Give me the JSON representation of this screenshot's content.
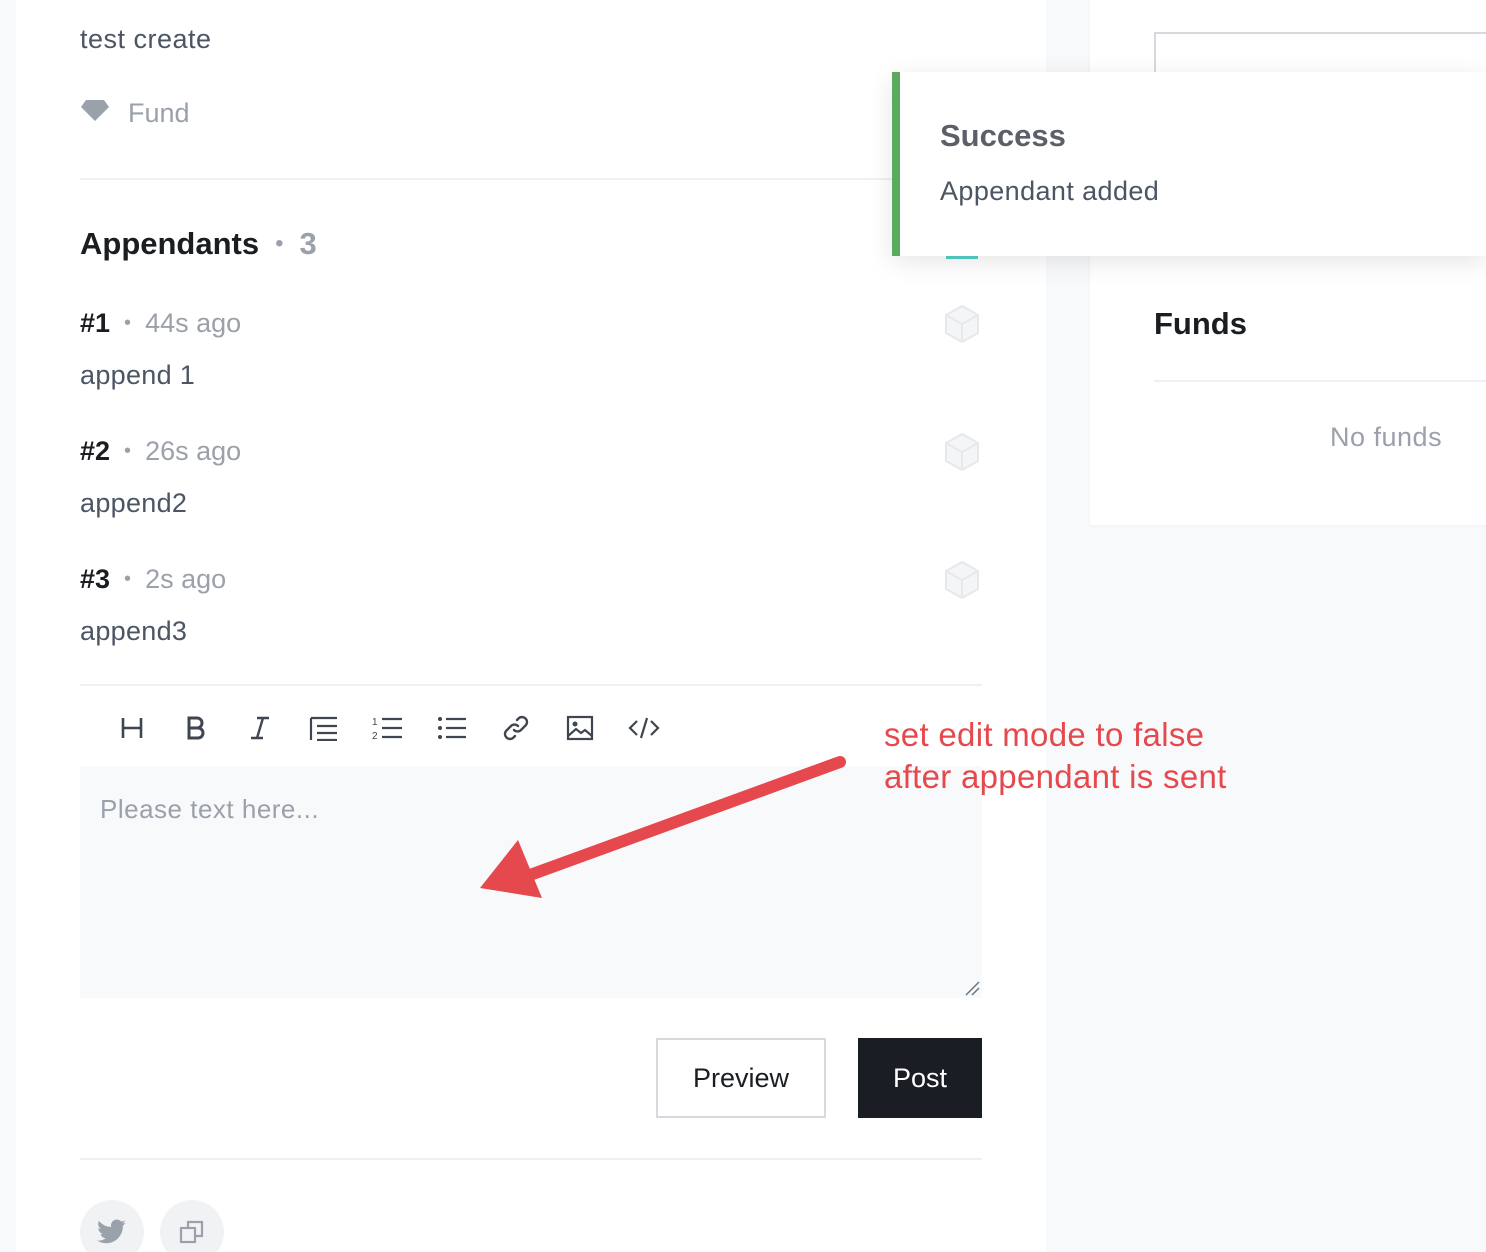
{
  "post": {
    "description": "test create",
    "fund_label": "Fund",
    "fund_icon": "diamond-icon"
  },
  "appendants": {
    "title": "Appendants",
    "count": "3",
    "items": [
      {
        "number": "#1",
        "time": "44s ago",
        "text": "append 1"
      },
      {
        "number": "#2",
        "time": "26s ago",
        "text": "append2"
      },
      {
        "number": "#3",
        "time": "2s ago",
        "text": "append3"
      }
    ]
  },
  "editor": {
    "placeholder": "Please text here...",
    "toolbar": [
      "heading-icon",
      "bold-icon",
      "italic-icon",
      "indent-list-icon",
      "ordered-list-icon",
      "bullet-list-icon",
      "link-icon",
      "image-icon",
      "code-icon"
    ],
    "preview_label": "Preview",
    "post_label": "Post"
  },
  "social": [
    "twitter-icon",
    "copy-link-icon"
  ],
  "sidebar": {
    "funds_title": "Funds",
    "no_funds": "No funds"
  },
  "toast": {
    "title": "Success",
    "message": "Appendant added",
    "accent_color": "#5aab5e"
  },
  "annotation": {
    "line1": "set edit mode to false",
    "line2": "after appendant is sent",
    "color": "#e5484d"
  }
}
